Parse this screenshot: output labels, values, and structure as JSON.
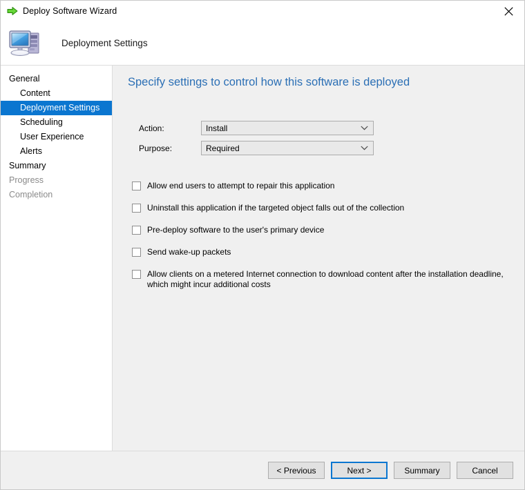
{
  "window": {
    "title": "Deploy Software Wizard",
    "title_icon": "green-arrow-icon",
    "close_icon": "close-icon"
  },
  "header": {
    "icon": "computer-icon",
    "title": "Deployment Settings"
  },
  "sidebar": {
    "items": [
      {
        "label": "General",
        "indent": false,
        "state": "normal"
      },
      {
        "label": "Content",
        "indent": true,
        "state": "normal"
      },
      {
        "label": "Deployment Settings",
        "indent": true,
        "state": "selected"
      },
      {
        "label": "Scheduling",
        "indent": true,
        "state": "normal"
      },
      {
        "label": "User Experience",
        "indent": true,
        "state": "normal"
      },
      {
        "label": "Alerts",
        "indent": true,
        "state": "normal"
      },
      {
        "label": "Summary",
        "indent": false,
        "state": "normal"
      },
      {
        "label": "Progress",
        "indent": false,
        "state": "disabled"
      },
      {
        "label": "Completion",
        "indent": false,
        "state": "disabled"
      }
    ]
  },
  "main": {
    "heading": "Specify settings to control how this software is deployed",
    "fields": [
      {
        "label": "Action:",
        "value": "Install",
        "name": "action-dropdown"
      },
      {
        "label": "Purpose:",
        "value": "Required",
        "name": "purpose-dropdown"
      }
    ],
    "checkboxes": [
      {
        "label": "Allow end users to attempt to repair this application",
        "checked": false,
        "name": "checkbox-allow-repair"
      },
      {
        "label": "Uninstall this application if the targeted object falls out of the collection",
        "checked": false,
        "name": "checkbox-uninstall-out-of-collection"
      },
      {
        "label": "Pre-deploy software to the user's primary device",
        "checked": false,
        "name": "checkbox-pre-deploy"
      },
      {
        "label": "Send wake-up packets",
        "checked": false,
        "name": "checkbox-wake-up-packets"
      },
      {
        "label": "Allow clients on a metered Internet connection to download content after the installation deadline, which might incur additional costs",
        "checked": false,
        "name": "checkbox-metered-connection"
      }
    ]
  },
  "footer": {
    "buttons": [
      {
        "label": "< Previous",
        "name": "previous-button",
        "focused": false
      },
      {
        "label": "Next >",
        "name": "next-button",
        "focused": true
      },
      {
        "label": "Summary",
        "name": "summary-button",
        "focused": false
      },
      {
        "label": "Cancel",
        "name": "cancel-button",
        "focused": false
      }
    ]
  },
  "colors": {
    "accent": "#0b76d0",
    "heading": "#2b6fb5",
    "window_bg": "#f0f0f0",
    "panel_bg": "#ffffff"
  }
}
